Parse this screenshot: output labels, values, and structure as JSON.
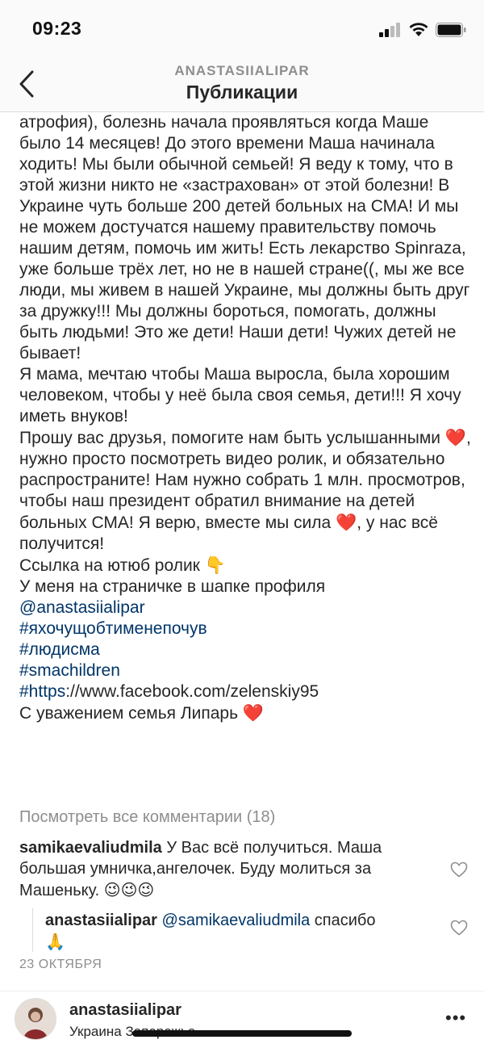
{
  "status_bar": {
    "time": "09:23"
  },
  "header": {
    "owner": "ANASTASIIALIPAR",
    "title": "Публикации"
  },
  "caption": {
    "text1": "атрофия), болезнь начала проявляться когда Маше было 14 месяцев! До этого времени Маша начинала ходить! Мы были обычной семьей! Я веду к тому, что в этой жизни никто не «застрахован» от этой болезни! В Украине чуть больше 200 детей больных на СМА! И мы не можем достучатся нашему правительству помочь нашим детям, помочь им жить! Есть лекарство Spinraza, уже больше трёх лет, но не в нашей стране((, мы же все люди, мы живем в нашей Украине, мы должны быть друг за дружку!!! Мы должны бороться, помогать, должны быть людьми! Это же дети! Наши дети! Чужих детей не бывает!",
    "text2": "Я мама, мечтаю чтобы Маша выросла, была хорошим человеком, чтобы у неё была своя семья, дети!!! Я хочу иметь внуков!",
    "text3a": "Прошу вас друзья, помогите нам быть услышанными",
    "text3b": ", нужно просто посмотреть видео ролик, и обязательно распространите! Нам нужно собрать 1 млн. просмотров, чтобы наш президент обратил внимание на детей больных СМА! Я верю, вместе мы сила",
    "text3c": ", у нас всё получится!",
    "youtube_line": "Ссылка на ютюб ролик",
    "profile_line": "У меня на страничке в шапке профиля",
    "mention": "@anastasiialipar",
    "hashtag1": "#яхочущобтименепочув",
    "hashtag2": "#людисма",
    "hashtag3": "#smachildren",
    "hashtag4": "#https",
    "url_rest": "://www.facebook.com/zelenskiy95",
    "signoff": "С уважением семья Липарь",
    "heart": "❤️",
    "point_down": "👇"
  },
  "comments": {
    "view_all": "Посмотреть все комментарии (18)",
    "first": {
      "user": "samikaevaliudmila",
      "text": "У Вас всё получиться. Маша большая умничка,ангелочек. Буду молиться за Машеньку.",
      "emojis": "😉😉😉"
    },
    "reply": {
      "user": "anastasiialipar",
      "mention": "@samikaevaliudmila",
      "text": "спасибо",
      "emoji": "🙏"
    },
    "date": "23 ОКТЯБРЯ"
  },
  "next_post": {
    "user": "anastasiialipar",
    "location": "Украина Запорожье",
    "more": "•••"
  }
}
